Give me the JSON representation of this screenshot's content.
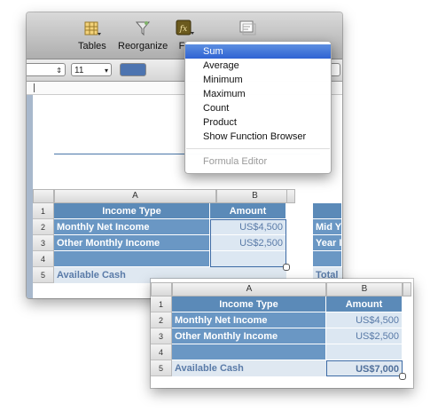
{
  "toolbar": {
    "tables_label": "Tables",
    "reorganize_label": "Reorganize",
    "functions_label": "Fu"
  },
  "format_bar": {
    "font_size": "11"
  },
  "menu": {
    "items": [
      "Sum",
      "Average",
      "Minimum",
      "Maximum",
      "Count",
      "Product",
      "Show Function Browser"
    ],
    "disabled_item": "Formula Editor",
    "selected_index": 0
  },
  "sheet": {
    "columns": [
      "A",
      "B"
    ],
    "rows": [
      "1",
      "2",
      "3",
      "4",
      "5"
    ],
    "header": [
      "Income Type",
      "Amount"
    ],
    "data": [
      [
        "Monthly Net Income",
        "US$4,500"
      ],
      [
        "Other Monthly Income",
        "US$2,500"
      ],
      [
        "",
        ""
      ]
    ],
    "footer_label": "Available Cash",
    "footer_value": "",
    "side_labels": [
      "Mid Y",
      "Year I",
      "Total"
    ]
  },
  "zoom_sheet": {
    "columns": [
      "A",
      "B"
    ],
    "rows": [
      "1",
      "2",
      "3",
      "4",
      "5"
    ],
    "header": [
      "Income Type",
      "Amount"
    ],
    "data": [
      [
        "Monthly Net Income",
        "US$4,500"
      ],
      [
        "Other Monthly Income",
        "US$2,500"
      ],
      [
        "",
        ""
      ]
    ],
    "footer_label": "Available Cash",
    "footer_value": "US$7,000"
  },
  "colors": {
    "header_cell": "#5b8ab8",
    "body_cell": "#6a97c4",
    "value_cell": "#dce7f2",
    "menu_highlight": "#3a6fd8"
  }
}
